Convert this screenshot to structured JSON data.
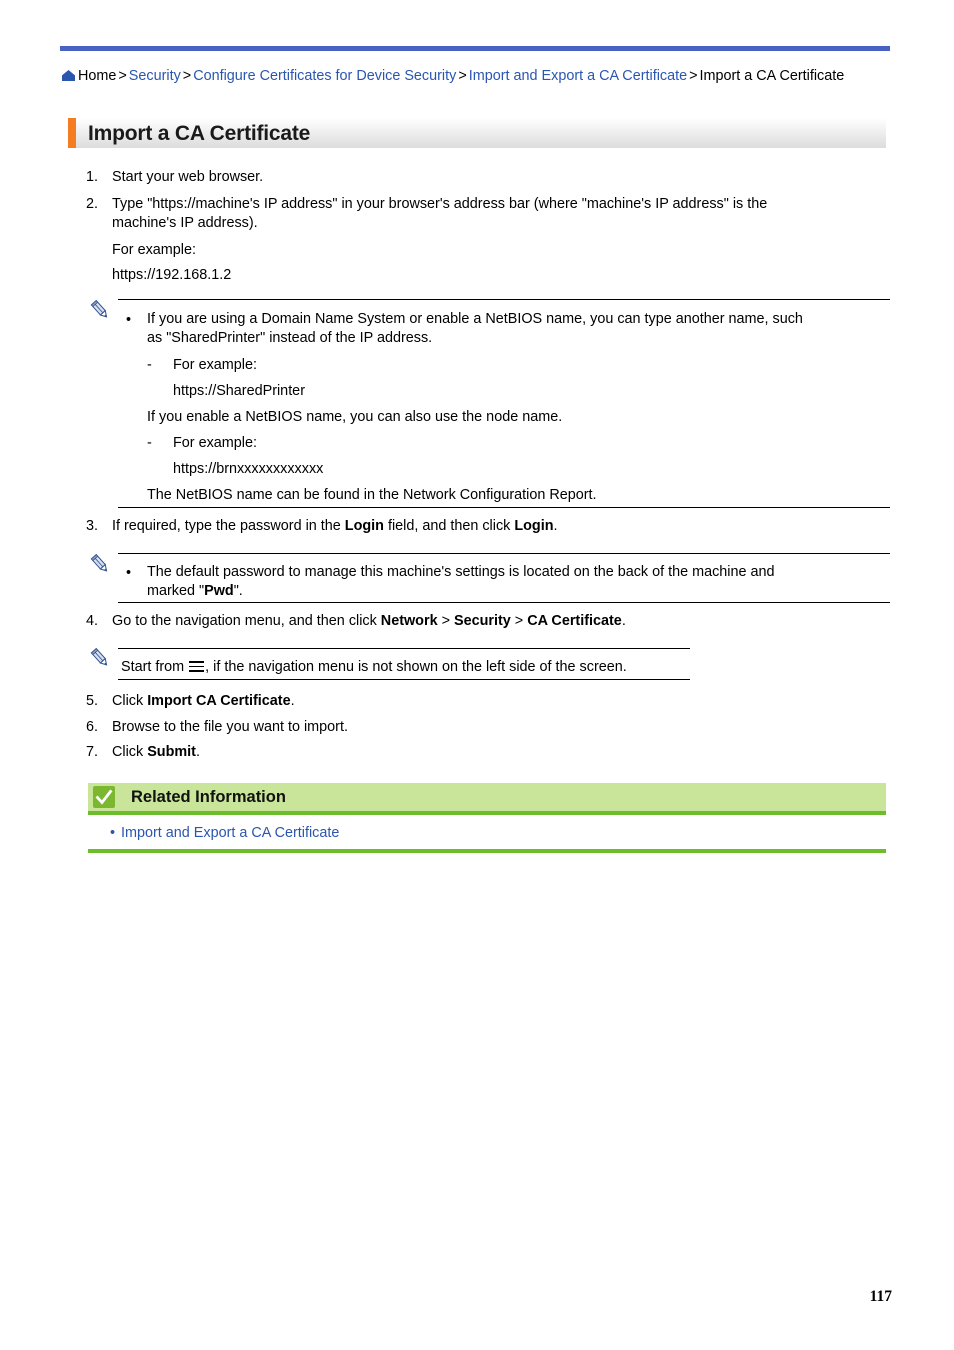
{
  "page": {
    "number": "117",
    "accent_orange": "#f57c20",
    "accent_blue": "#4862c4",
    "link_blue": "#2b56b0",
    "related_green_band": "#c9e59a",
    "related_green_rule": "#6cbd2c"
  },
  "breadcrumb": {
    "home_label": "Home",
    "sep": ">",
    "links": [
      "Security",
      "Configure Certificates for Device Security",
      "Import and Export a CA Certificate"
    ],
    "current": "Import a CA Certificate"
  },
  "title": "Import a CA Certificate",
  "steps": {
    "n1": "1.",
    "s1": "Start your web browser.",
    "n2": "2.",
    "s2_line1": "Type \"https://machine's IP address\" in your browser's address bar (where \"machine's IP address\" is the",
    "s2_line2": "machine's IP address).",
    "s2_example_label": "For example:",
    "s2_example_url": "https://192.168.1.2",
    "n3": "3.",
    "s3_pre": "If required, type the password in the ",
    "s3_b1": "Login",
    "s3_mid": " field, and then click ",
    "s3_b2": "Login",
    "s3_post": ".",
    "n4": "4.",
    "s4_pre": "Go to the navigation menu, and then click ",
    "s4_b1": "Network",
    "s4_sep1": " > ",
    "s4_b2": "Security",
    "s4_sep2": " > ",
    "s4_b3": "CA Certificate",
    "s4_post": ".",
    "n5": "5.",
    "s5_pre": "Click ",
    "s5_b1": "Import CA Certificate",
    "s5_post": ".",
    "n6": "6.",
    "s6": "Browse to the file you want to import.",
    "n7": "7.",
    "s7_pre": "Click ",
    "s7_b1": "Submit",
    "s7_post": "."
  },
  "note1": {
    "icon": "pencil-icon",
    "bullet": "•",
    "line1": "If you are using a Domain Name System or enable a NetBIOS name, you can type another name, such",
    "line2": "as \"SharedPrinter\" instead of the IP address.",
    "dash1": "-",
    "sub1_label": "For example:",
    "sub1_url": "https://SharedPrinter",
    "mid_text": "If you enable a NetBIOS name, you can also use the node name.",
    "dash2": "-",
    "sub2_label": "For example:",
    "sub2_url": "https://brnxxxxxxxxxxxx",
    "tail_text": "The NetBIOS name can be found in the Network Configuration Report."
  },
  "note2": {
    "icon": "pencil-icon",
    "bullet": "•",
    "line1": "The default password to manage this machine's settings is located on the back of the machine and",
    "line2_pre": "marked \"",
    "line2_b": "Pwd",
    "line2_post": "\"."
  },
  "note3": {
    "icon": "pencil-icon",
    "menu_icon": "hamburger-menu-icon",
    "text_pre": "Start from ",
    "text_post": ", if the navigation menu is not shown on the left side of the screen."
  },
  "related_information": {
    "icon": "checkmark-icon",
    "title": "Related Information",
    "bullet": "•",
    "links": [
      "Import and Export a CA Certificate"
    ]
  }
}
